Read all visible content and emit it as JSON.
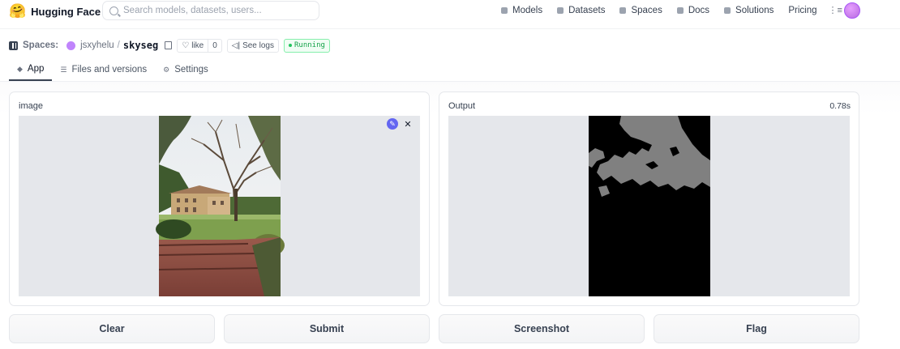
{
  "nav": {
    "brand": "Hugging Face",
    "search_placeholder": "Search models, datasets, users...",
    "links": [
      "Models",
      "Datasets",
      "Spaces",
      "Docs",
      "Solutions",
      "Pricing"
    ]
  },
  "space": {
    "label": "Spaces:",
    "owner": "jsxyhelu",
    "separator": "/",
    "name": "skyseg",
    "like_label": "like",
    "like_count": "0",
    "logs_label": "See logs",
    "status": "Running"
  },
  "tabs": [
    "App",
    "Files and versions",
    "Settings"
  ],
  "input_panel": {
    "label": "image"
  },
  "output_panel": {
    "label": "Output",
    "time": "0.78s"
  },
  "buttons": {
    "clear": "Clear",
    "submit": "Submit",
    "screenshot": "Screenshot",
    "flag": "Flag"
  },
  "colors": {
    "accent": "#6366f1",
    "running": "#16a34a",
    "avatar": "#c084fc"
  },
  "icons": [
    "hugging-face-logo-icon",
    "search-icon",
    "user-avatar",
    "space-icon",
    "copy-icon",
    "heart-icon",
    "logs-icon",
    "edit-icon",
    "close-icon"
  ]
}
